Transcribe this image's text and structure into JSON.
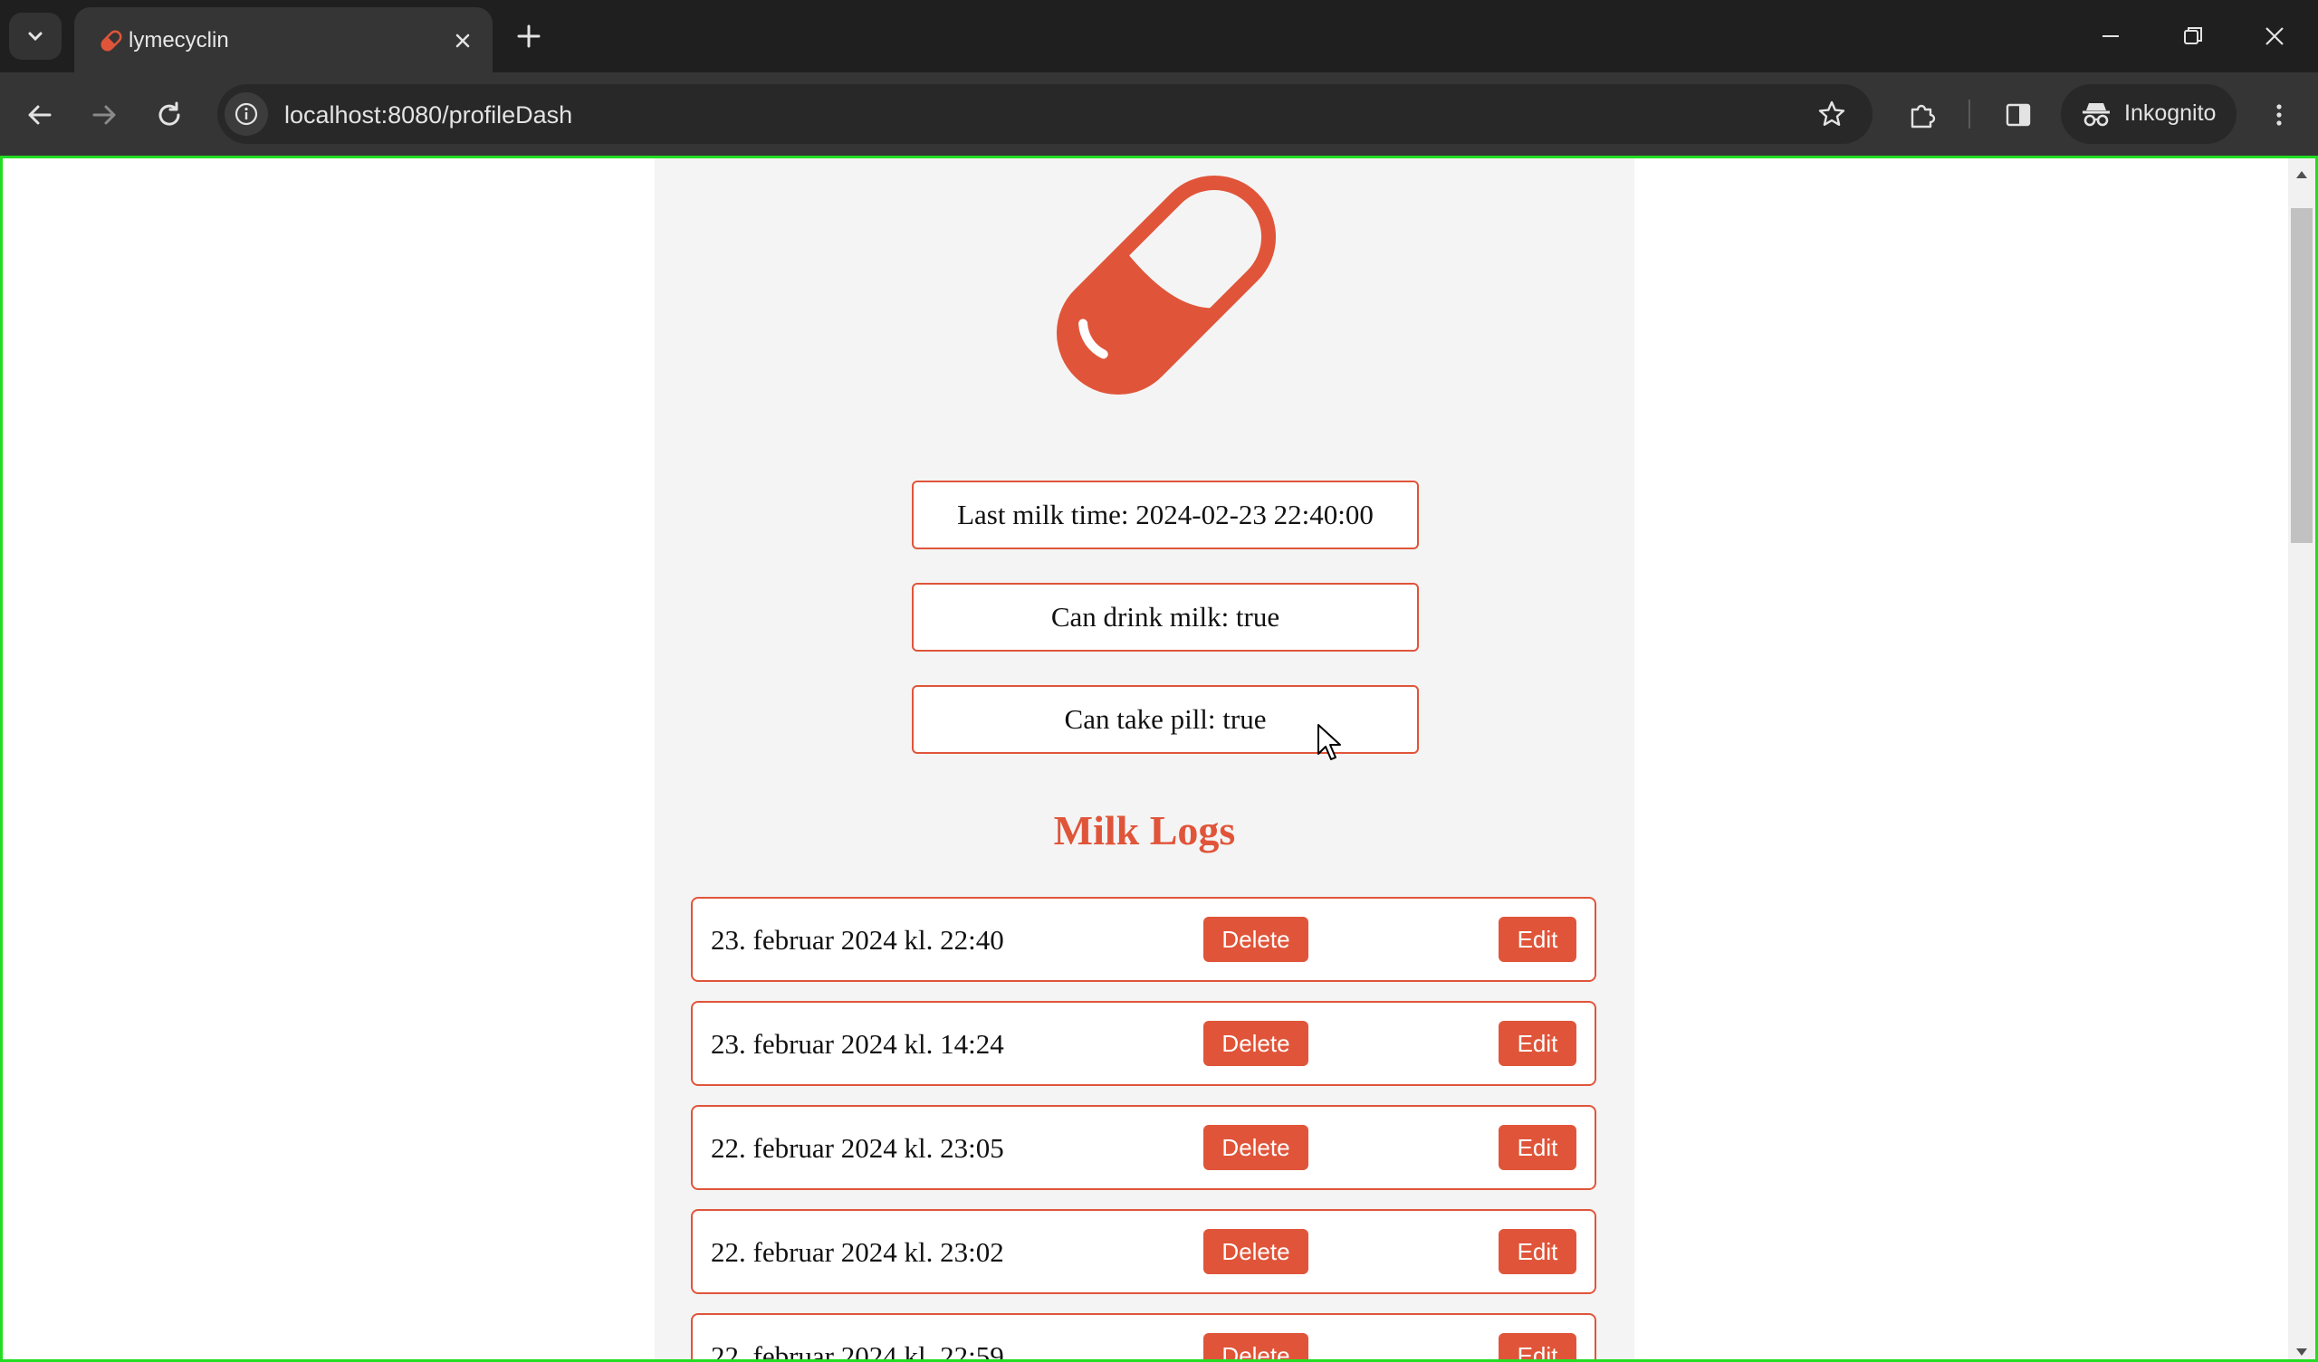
{
  "browser": {
    "tab_title": "lymecyclin",
    "url": "localhost:8080/profileDash",
    "incognito_label": "Inkognito"
  },
  "theme": {
    "accent": "#e0553a"
  },
  "status": {
    "last_milk_time": "Last milk time: 2024-02-23 22:40:00",
    "can_drink_milk": "Can drink milk: true",
    "can_take_pill": "Can take pill: true"
  },
  "milk_logs": {
    "title": "Milk Logs",
    "delete_label": "Delete",
    "edit_label": "Edit",
    "items": [
      {
        "date": "23. februar 2024 kl. 22:40"
      },
      {
        "date": "23. februar 2024 kl. 14:24"
      },
      {
        "date": "22. februar 2024 kl. 23:05"
      },
      {
        "date": "22. februar 2024 kl. 23:02"
      },
      {
        "date": "22. februar 2024 kl. 22:59"
      }
    ]
  }
}
